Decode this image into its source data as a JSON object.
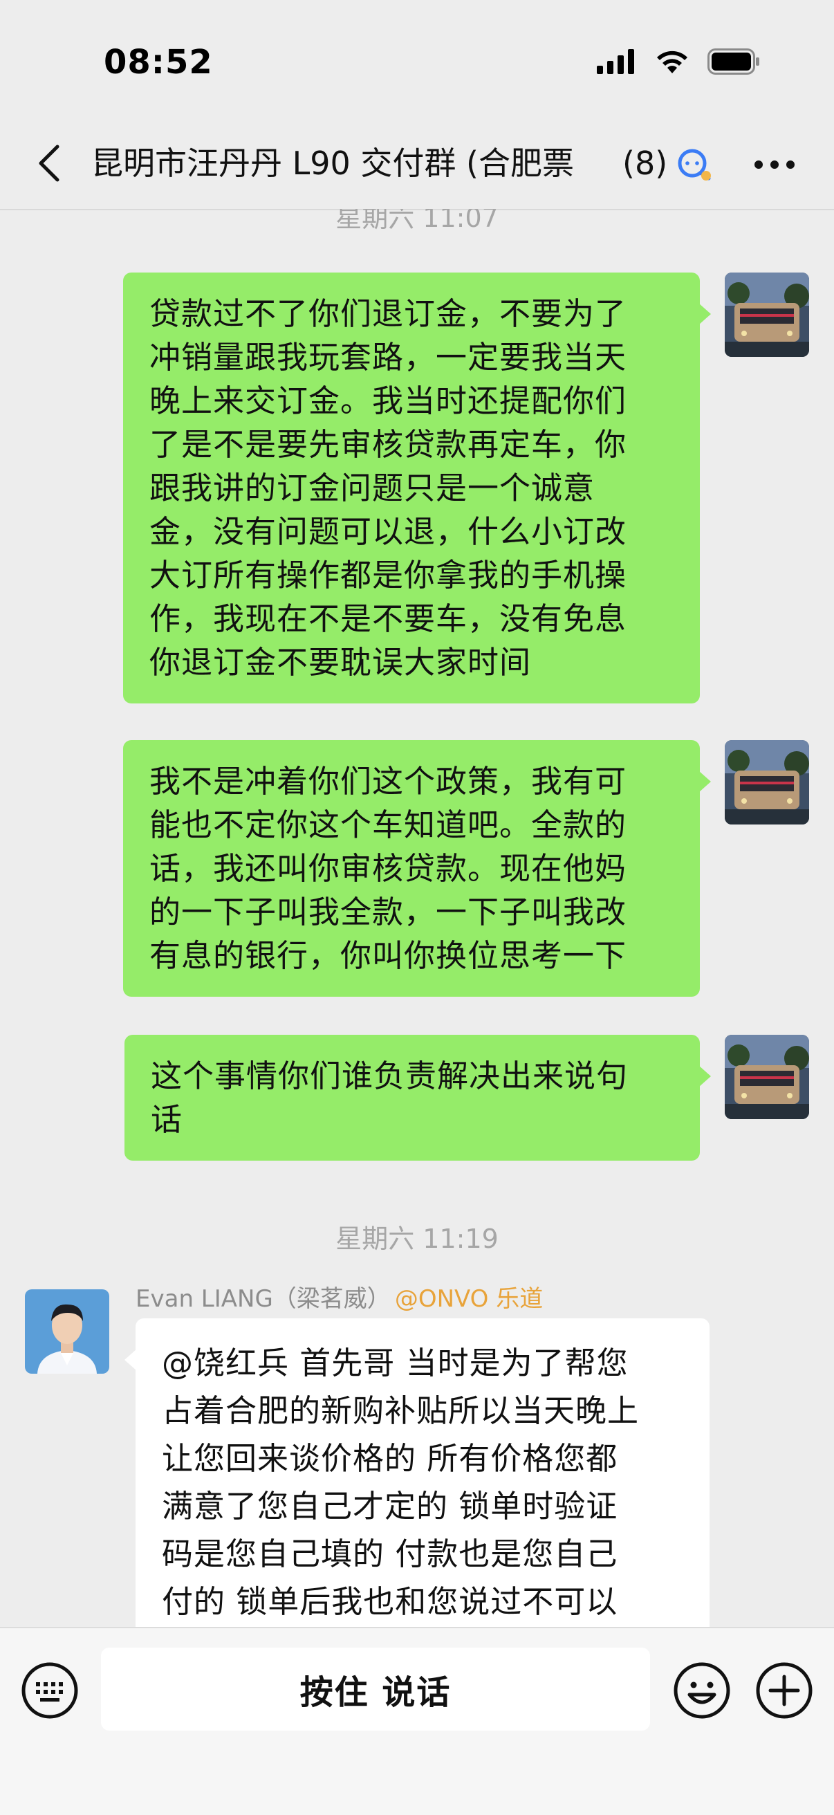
{
  "status_bar": {
    "time": "08:52",
    "signal_icon": "cellular-signal-icon",
    "wifi_icon": "wifi-icon",
    "battery_icon": "battery-icon"
  },
  "nav": {
    "title": "昆明市汪丹丹 L90 交付群 (合肥票",
    "member_count": "(8)",
    "back_icon": "chevron-left-icon",
    "group_icon": "group-chat-icon",
    "more_icon": "more-dots-icon"
  },
  "chat": {
    "top_timestamp": "星期六 11:07",
    "messages_out": [
      {
        "lines": [
          "贷款过不了你们退订金，不要为了",
          "冲销量跟我玩套路，一定要我当天",
          "晚上来交订金。我当时还提配你们",
          "了是不是要先审核贷款再定车，你",
          "跟我讲的订金问题只是一个诚意",
          "金，没有问题可以退，什么小订改",
          "大订所有操作都是你拿我的手机操",
          "作，我现在不是不要车，没有免息",
          "你退订金不要耽误大家时间"
        ]
      },
      {
        "lines": [
          "我不是冲着你们这个政策，我有可",
          "能也不定你这个车知道吧。全款的",
          "话，我还叫你审核贷款。现在他妈",
          "的一下子叫我全款，一下子叫我改",
          "有息的银行，你叫你换位思考一下"
        ]
      },
      {
        "lines": [
          "这个事情你们谁负责解决出来说句",
          "话"
        ]
      }
    ],
    "second_timestamp": "星期六 11:19",
    "incoming": {
      "sender_name": "Evan LIANG（梁茗威）",
      "sender_org": "@ONVO 乐道",
      "lines": [
        "@饶红兵 首先哥 当时是为了帮您",
        "占着合肥的新购补贴所以当天晚上",
        "让您回来谈价格的 所有价格您都",
        "满意了您自己才定的 锁单时验证",
        "码是您自己填的 付款也是您自己",
        "付的 锁单后我也和您说过不可以"
      ]
    }
  },
  "input_bar": {
    "hold_to_talk": "按住 说话",
    "keyboard_icon": "keyboard-icon",
    "emoji_icon": "emoji-icon",
    "plus_icon": "plus-icon"
  },
  "colors": {
    "outgoing_bubble": "#95ec69",
    "incoming_bubble": "#ffffff",
    "background": "#ededed",
    "org_tag": "#e8a33a"
  }
}
